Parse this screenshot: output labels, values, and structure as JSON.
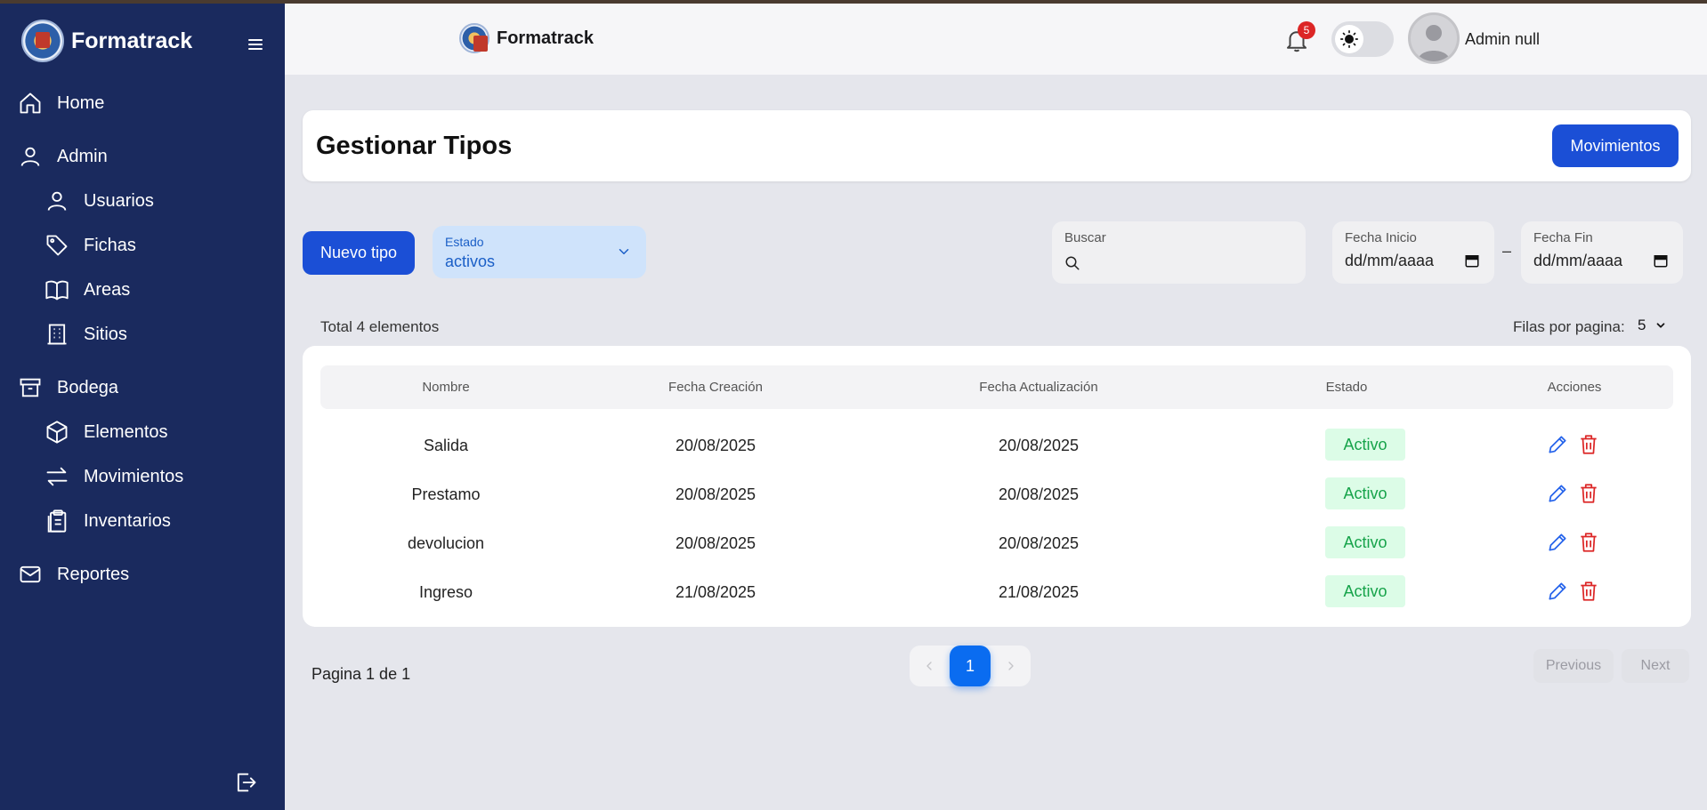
{
  "app": {
    "name": "Formatrack"
  },
  "sidebar": {
    "items": [
      {
        "label": "Home",
        "icon": "home-icon"
      },
      {
        "label": "Admin",
        "icon": "user-icon"
      },
      {
        "label": "Usuarios",
        "icon": "user-icon"
      },
      {
        "label": "Fichas",
        "icon": "tag-icon"
      },
      {
        "label": "Areas",
        "icon": "book-icon"
      },
      {
        "label": "Sitios",
        "icon": "building-icon"
      },
      {
        "label": "Bodega",
        "icon": "archive-icon"
      },
      {
        "label": "Elementos",
        "icon": "box-icon"
      },
      {
        "label": "Movimientos",
        "icon": "arrows-icon"
      },
      {
        "label": "Inventarios",
        "icon": "clipboard-icon"
      },
      {
        "label": "Reportes",
        "icon": "mail-icon"
      }
    ]
  },
  "header": {
    "brand": "Formatrack",
    "notifications": "5",
    "user_name": "Admin null"
  },
  "page": {
    "title": "Gestionar Tipos",
    "movimientos_button": "Movimientos",
    "new_button": "Nuevo tipo"
  },
  "filters": {
    "estado_label": "Estado",
    "estado_value": "activos",
    "search_label": "Buscar",
    "fecha_inicio_label": "Fecha Inicio",
    "fecha_inicio_value": "dd/mm/aaaa",
    "separator": "–",
    "fecha_fin_label": "Fecha Fin",
    "fecha_fin_value": "dd/mm/aaaa"
  },
  "summary": {
    "total": "Total 4 elementos",
    "rows_label": "Filas por pagina:",
    "rows_value": "5"
  },
  "table": {
    "headers": [
      "Nombre",
      "Fecha Creación",
      "Fecha Actualización",
      "Estado",
      "Acciones"
    ],
    "rows": [
      {
        "nombre": "Salida",
        "creacion": "20/08/2025",
        "actualizacion": "20/08/2025",
        "estado": "Activo"
      },
      {
        "nombre": "Prestamo",
        "creacion": "20/08/2025",
        "actualizacion": "20/08/2025",
        "estado": "Activo"
      },
      {
        "nombre": "devolucion",
        "creacion": "20/08/2025",
        "actualizacion": "20/08/2025",
        "estado": "Activo"
      },
      {
        "nombre": "Ingreso",
        "creacion": "21/08/2025",
        "actualizacion": "21/08/2025",
        "estado": "Activo"
      }
    ]
  },
  "pagination": {
    "info": "Pagina 1 de 1",
    "current": "1",
    "previous": "Previous",
    "next": "Next"
  },
  "colors": {
    "sidebar_bg": "#1a2a5e",
    "primary": "#1b4fd6",
    "active_badge_bg": "#dcfce7",
    "active_badge_text": "#16a34a",
    "edit_icon": "#2563eb",
    "delete_icon": "#dc2626"
  }
}
